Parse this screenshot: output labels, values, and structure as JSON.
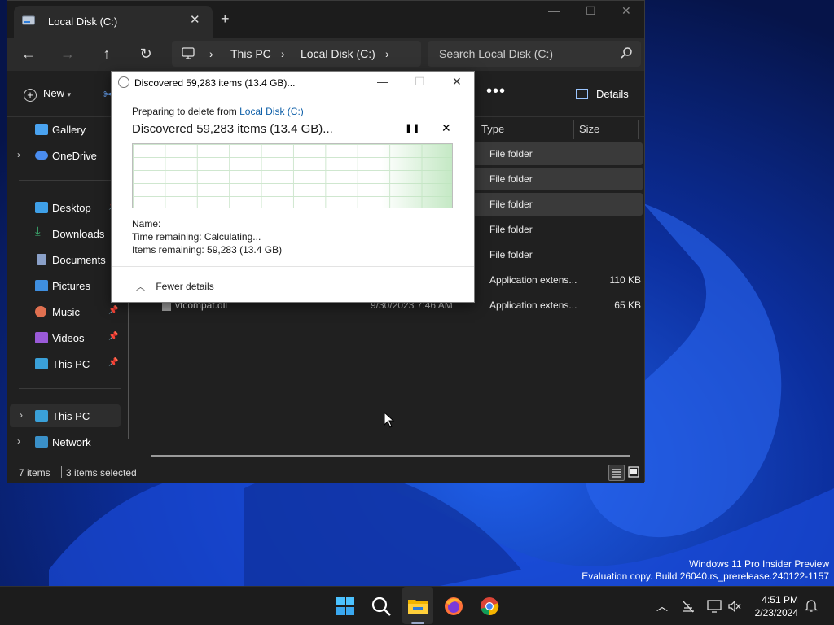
{
  "explorer": {
    "tab_title": "Local Disk (C:)",
    "tab_close": "✕",
    "new_tab": "+",
    "window_controls": [
      "—",
      "☐",
      "✕"
    ],
    "nav": {
      "back": "←",
      "forward": "→",
      "up": "↑",
      "refresh": "↻"
    },
    "breadcrumb": [
      "This PC",
      "Local Disk (C:)"
    ],
    "breadcrumb_sep": "›",
    "search_placeholder": "Search Local Disk (C:)",
    "toolbar": {
      "new_label": "New",
      "more_label": "•••",
      "details_label": "Details"
    },
    "sidebar": [
      {
        "label": "Gallery",
        "icon": "gallery-icon",
        "color": "#4aa3f0"
      },
      {
        "label": "OneDrive",
        "icon": "onedrive-icon",
        "color": "#4a8df0"
      },
      {
        "label": "Desktop",
        "icon": "desktop-icon",
        "color": "#3fa0e8"
      },
      {
        "label": "Downloads",
        "icon": "downloads-icon",
        "color": "#3fc07a"
      },
      {
        "label": "Documents",
        "icon": "documents-icon",
        "color": "#8aa0c8"
      },
      {
        "label": "Pictures",
        "icon": "pictures-icon",
        "color": "#3f8fe0"
      },
      {
        "label": "Music",
        "icon": "music-icon",
        "color": "#e07050"
      },
      {
        "label": "Videos",
        "icon": "videos-icon",
        "color": "#9a5ad8"
      },
      {
        "label": "This PC",
        "icon": "this-pc-icon",
        "color": "#3aa0d8"
      },
      {
        "label": "This PC",
        "icon": "this-pc-icon",
        "color": "#3aa0d8"
      },
      {
        "label": "Network",
        "icon": "network-icon",
        "color": "#3a90c8"
      }
    ],
    "columns": {
      "type": "Type",
      "size": "Size"
    },
    "rows": [
      {
        "type": "File folder",
        "size": "",
        "name": "",
        "date": "",
        "selected": true
      },
      {
        "type": "File folder",
        "size": "",
        "name": "",
        "date": "",
        "selected": true
      },
      {
        "type": "File folder",
        "size": "",
        "name": "",
        "date": "",
        "selected": true
      },
      {
        "type": "File folder",
        "size": "",
        "name": "",
        "date": "",
        "selected": false
      },
      {
        "type": "File folder",
        "size": "",
        "name": "",
        "date": "",
        "selected": false
      },
      {
        "type": "Application extens...",
        "size": "110 KB",
        "name": "",
        "date": "",
        "selected": false
      },
      {
        "type": "Application extens...",
        "size": "65 KB",
        "name": "vfcompat.dll",
        "date": "9/30/2023 7:46 AM",
        "selected": false
      }
    ],
    "status": {
      "items": "7 items",
      "selected": "3 items selected"
    }
  },
  "dialog": {
    "title": "Discovered 59,283 items (13.4 GB)...",
    "controls": [
      "—",
      "☐",
      "✕"
    ],
    "preparing_prefix": "Preparing to delete from",
    "preparing_location": "Local Disk (C:)",
    "discovered": "Discovered 59,283 items (13.4 GB)...",
    "pause": "❚❚",
    "stop": "✕",
    "name_label": "Name:",
    "time_remaining": "Time remaining:  Calculating...",
    "items_remaining": "Items remaining:  59,283 (13.4 GB)",
    "fewer_details": "Fewer details",
    "fewer_chevron": "︿"
  },
  "desktop": {
    "watermark_line1": "Windows 11 Pro Insider Preview",
    "watermark_line2": "Evaluation copy. Build 26040.rs_prerelease.240122-1157"
  },
  "taskbar": {
    "apps": [
      "start-icon",
      "search-icon",
      "file-explorer-icon",
      "firefox-icon",
      "chrome-icon"
    ],
    "tray": {
      "chevron": "︿"
    },
    "time": "4:51 PM",
    "date": "2/23/2024"
  }
}
